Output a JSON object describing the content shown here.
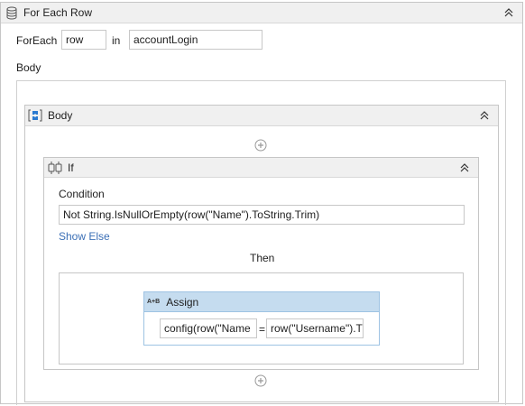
{
  "for_each_row": {
    "title": "For Each Row",
    "foreach_label": "ForEach",
    "item_var": "row",
    "in_label": "in",
    "collection": "accountLogin",
    "body_label": "Body"
  },
  "body_sequence": {
    "title": "Body"
  },
  "if_activity": {
    "title": "If",
    "condition_label": "Condition",
    "condition_value": "Not String.IsNullOrEmpty(row(\"Name\").ToString.Trim)",
    "show_else": "Show Else",
    "then_label": "Then"
  },
  "assign": {
    "icon_text": "A+B",
    "title": "Assign",
    "to_value": "config(row(\"Name",
    "equals": "=",
    "value": "row(\"Username\").T"
  },
  "colors": {
    "header_bg": "#f0f0f0",
    "assign_header_bg": "#c5dcef",
    "link": "#3b6fb6"
  }
}
